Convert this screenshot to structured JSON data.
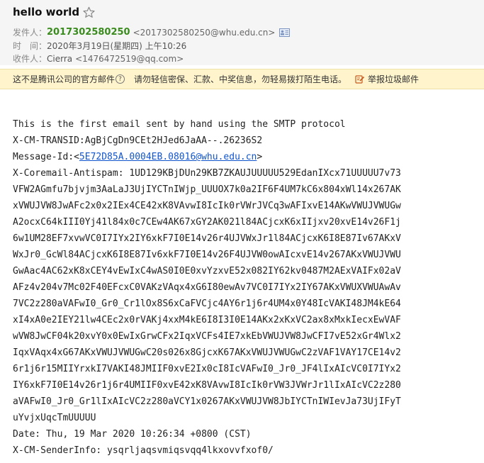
{
  "subject": "hello world",
  "meta": {
    "from_label": "发件人：",
    "from_name": "2017302580250",
    "from_addr": "<2017302580250@whu.edu.cn>",
    "time_label": "时　间：",
    "time_value": "2020年3月19日(星期四) 上午10:26",
    "to_label": "收件人：",
    "to_name": "Cierra",
    "to_addr": "<1476472519@qq.com>"
  },
  "notice": {
    "text1": "这不是腾讯公司的官方邮件",
    "qmark": "?",
    "text2": "请勿轻信密保、汇款、中奖信息，勿轻易拨打陌生电话。",
    "report": "举报垃圾邮件"
  },
  "body": {
    "intro": "This is the first email sent by hand using the SMTP protocol",
    "transid": "X-CM-TRANSID:AgBjCgDn9CEt2HJed6JaAA--.26236S2",
    "msgid_prefix": "Message-Id:<",
    "msgid_link": "5E72D85A.0004EB.08016@whu.edu.cn",
    "msgid_suffix": ">",
    "antispam": [
      "X-Coremail-Antispam: 1UD129KBjDUn29KB7ZKAUJUUUUU529EdanIXcx71UUUUU7v73",
      "VFW2AGmfu7bjvjm3AaLaJ3UjIYCTnIWjp_UUUOX7k0a2IF6F4UM7kC6x804xWl14x267AK",
      "xVWUJVW8JwAFc2x0x2IEx4CE42xK8VAvwI8IcIk0rVWrJVCq3wAFIxvE14AKwVWUJVWUGw",
      "A2ocxC64kIII0Yj41l84x0c7CEw4AK67xGY2AK021l84ACjcxK6xIIjxv20xvE14v26F1j",
      "6w1UM28EF7xvwVC0I7IYx2IY6xkF7I0E14v26r4UJVWxJr1l84ACjcxK6I8E87Iv67AKxV",
      "WxJr0_GcWl84ACjcxK6I8E87Iv6xkF7I0E14v26F4UJVW0owAIcxvE14v267AKxVWUJVWU",
      "GwAac4AC62xK8xCEY4vEwIxC4wAS0I0E0xvYzxvE52x082IY62kv0487M2AExVAIFx02aV",
      "AFz4v204v7Mc02F40EFcxC0VAKzVAqx4xG6I80ewAv7VC0I7IYx2IY67AKxVWUXVWUAwAv",
      "7VC2z280aVAFwI0_Gr0_Cr1lOx8S6xCaFVCjc4AY6r1j6r4UM4x0Y48IcVAKI48JM4kE64",
      "xI4xA0e2IEY21lw4CEc2x0rVAKj4xxM4kE6I8I3I0E14AKx2xKxVC2ax8xMxkIecxEwVAF",
      "wVW8JwCF04k20xvY0x0EwIxGrwCFx2IqxVCFs4IE7xkEbVWUJVW8JwCFI7vE52xGr4Wlx2",
      "IqxVAqx4xG67AKxVWUJVWUGwC20s026x8GjcxK67AKxVWUJVWUGwC2zVAF1VAY17CE14v2",
      "6r1j6r15MIIYrxkI7VAKI48JMIIF0xvE2Ix0cI8IcVAFwI0_Jr0_JF4lIxAIcVC0I7IYx2",
      "IY6xkF7I0E14v26r1j6r4UMIIF0xvE42xK8VAvwI8IcIk0rVW3JVWrJr1lIxAIcVC2z280",
      "aVAFwI0_Jr0_Gr1lIxAIcVC2z280aVCY1x0267AKxVWUJVW8JbIYCTnIWIevJa73UjIFyT",
      "uYvjxUqcTmUUUUU"
    ],
    "date": "Date: Thu, 19 Mar 2020 10:26:34 +0800 (CST)",
    "sender_info": "X-CM-SenderInfo: ysqrljaqsvmiqsvqq4lkxovvfxof0/"
  }
}
